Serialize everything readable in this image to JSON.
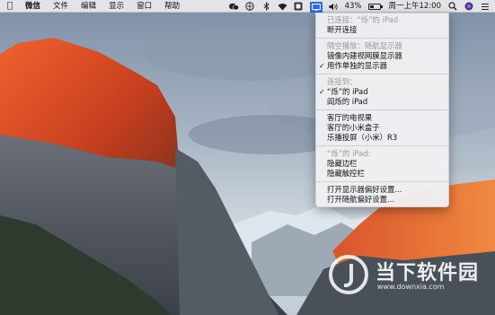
{
  "menubar": {
    "app_name": "微信",
    "items": [
      "文件",
      "编辑",
      "显示",
      "窗口",
      "帮助"
    ],
    "battery_percent_label": "43%",
    "battery_level": 0.43,
    "clock": "周一上午12:00",
    "icons": [
      "apple-icon",
      "wechat-icon",
      "lang-icon",
      "bluetooth-icon",
      "wifi-icon",
      "app-badge-icon",
      "display-icon",
      "volume-icon",
      "battery-icon",
      "search-icon",
      "siri-icon",
      "list-icon"
    ]
  },
  "menu": {
    "connected_header": "已连接：“烁”的 iPad",
    "disconnect": "断开连接",
    "airplay_header": "隔空播放：随航显示器",
    "mirror_option": "镜像内建视网膜显示器",
    "separate_option": "用作单独的显示器",
    "connect_to_header": "连接到：",
    "device1": "“烁”的 iPad",
    "device2": "阎烁的 iPad",
    "tv1": "客厅的电视果",
    "tv2": "客厅的小米盒子",
    "tv3": "乐播投屏（小米）R3",
    "ipad_header": "“烁”的 iPad:",
    "hide_sidebar": "隐藏边栏",
    "hide_touchbar": "隐藏触控栏",
    "open_display_prefs": "打开显示器偏好设置...",
    "open_sidecar_prefs": "打开随航偏好设置..."
  },
  "watermark": {
    "name": "当下软件园",
    "url": "www.downxia.com"
  },
  "colors": {
    "accent": "#2a6ae0",
    "cliff_light": "#e8552a",
    "cliff_dark": "#7a2a1c"
  }
}
